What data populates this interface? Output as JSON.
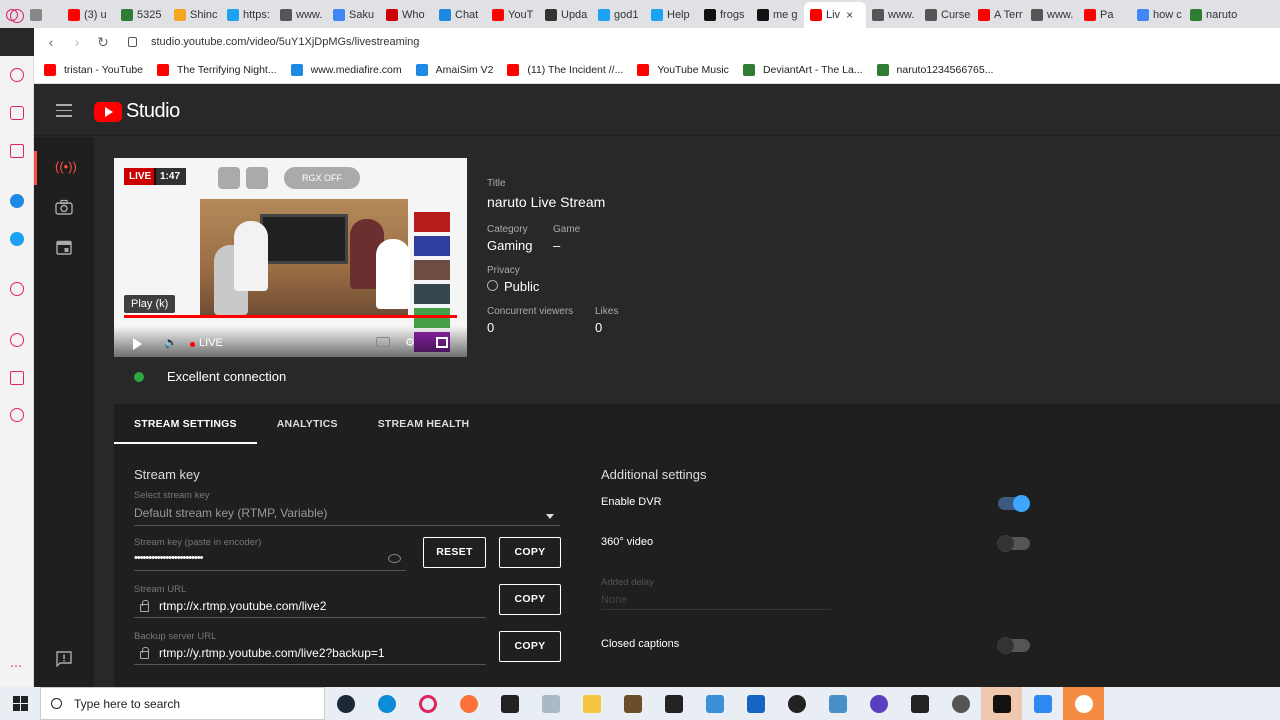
{
  "browser": {
    "tabs": [
      {
        "label": "(3) u",
        "color": "#ff0000"
      },
      {
        "label": "5325",
        "color": "#2e7d32"
      },
      {
        "label": "Shinc",
        "color": "#f5a623"
      },
      {
        "label": "https:",
        "color": "#1da1f2"
      },
      {
        "label": "www.",
        "color": "#555555"
      },
      {
        "label": "Saku",
        "color": "#4285f4"
      },
      {
        "label": "Who",
        "color": "#cc0000"
      },
      {
        "label": "Chat",
        "color": "#1e88e5"
      },
      {
        "label": "YouT",
        "color": "#ff0000"
      },
      {
        "label": "Upda",
        "color": "#333333"
      },
      {
        "label": "god1",
        "color": "#1da1f2"
      },
      {
        "label": "Help",
        "color": "#1da1f2"
      },
      {
        "label": "frogs",
        "color": "#111111"
      },
      {
        "label": "me g",
        "color": "#111111"
      },
      {
        "label": "Liv",
        "color": "#ff0000"
      },
      {
        "label": "www.",
        "color": "#555555"
      },
      {
        "label": "Curse",
        "color": "#555555"
      },
      {
        "label": "A Terr",
        "color": "#ff0000"
      },
      {
        "label": "www.",
        "color": "#555555"
      },
      {
        "label": "Pa",
        "color": "#ff0000"
      },
      {
        "label": "how c",
        "color": "#4285f4"
      },
      {
        "label": "naruto",
        "color": "#2e7d32"
      }
    ],
    "active_tab_index": 14,
    "url": "studio.youtube.com/video/5uY1XjDpMGs/livestreaming",
    "bookmarks": [
      {
        "label": "tristan - YouTube",
        "color": "#ff0000"
      },
      {
        "label": "The Terrifying Night...",
        "color": "#ff0000"
      },
      {
        "label": "www.mediafire.com",
        "color": "#1e88e5"
      },
      {
        "label": "AmaiSim V2",
        "color": "#1e88e5"
      },
      {
        "label": "(11) The Incident //...",
        "color": "#ff0000"
      },
      {
        "label": "YouTube Music",
        "color": "#ff0000"
      },
      {
        "label": "DeviantArt - The La...",
        "color": "#2e7d32"
      },
      {
        "label": "naruto1234566765...",
        "color": "#2e7d32"
      }
    ]
  },
  "studio": {
    "logo_text": "Studio",
    "preview": {
      "live_badge": "LIVE",
      "live_time": "1:47",
      "rgx_label": "RGX OFF",
      "tooltip": "Play (k)",
      "live_label": "LIVE",
      "progress_fraction": 1.0
    },
    "details": {
      "title_label": "Title",
      "title_value": "naruto Live Stream",
      "category_label": "Category",
      "category_value": "Gaming",
      "game_label": "Game",
      "game_value": "–",
      "privacy_label": "Privacy",
      "privacy_value": "Public",
      "viewers_label": "Concurrent viewers",
      "viewers_value": "0",
      "likes_label": "Likes",
      "likes_value": "0"
    },
    "connection": "Excellent connection",
    "connection_color": "#2ba640",
    "tabs": [
      "STREAM SETTINGS",
      "ANALYTICS",
      "STREAM HEALTH"
    ],
    "stream": {
      "section_title": "Stream key",
      "select_label": "Select stream key",
      "select_value": "Default stream key (RTMP, Variable)",
      "key_label": "Stream key (paste in encoder)",
      "key_value": "••••••••••••••••••••••••",
      "reset_label": "RESET",
      "copy_label": "COPY",
      "url_label": "Stream URL",
      "url_value": "rtmp://x.rtmp.youtube.com/live2",
      "backup_label": "Backup server URL",
      "backup_value": "rtmp://y.rtmp.youtube.com/live2?backup=1"
    },
    "additional": {
      "section_title": "Additional settings",
      "dvr_label": "Enable DVR",
      "dvr_on": true,
      "video360_label": "360° video",
      "video360_on": false,
      "delay_label": "Added delay",
      "delay_value": "None",
      "captions_label": "Closed captions",
      "captions_on": false
    },
    "accent_color": "#3ea6ff"
  },
  "taskbar": {
    "search_placeholder": "Type here to search"
  }
}
